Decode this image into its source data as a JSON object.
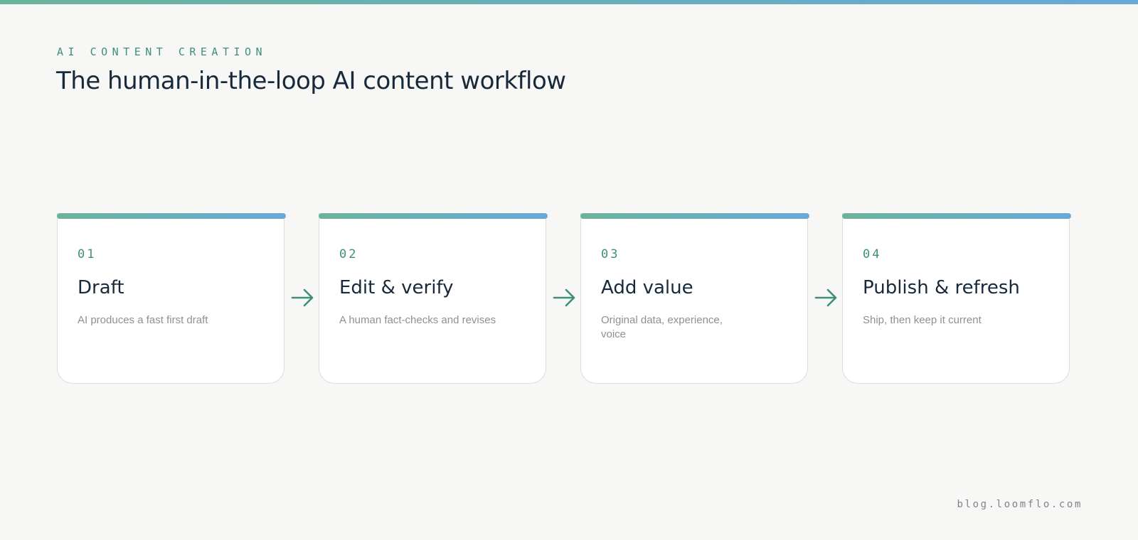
{
  "header": {
    "eyebrow": "AI CONTENT CREATION",
    "title": "The human-in-the-loop AI content workflow"
  },
  "steps": [
    {
      "number": "01",
      "title": "Draft",
      "description": "AI produces a fast first draft"
    },
    {
      "number": "02",
      "title": "Edit & verify",
      "description": "A human fact-checks and revises"
    },
    {
      "number": "03",
      "title": "Add value",
      "description": "Original data, experience, voice"
    },
    {
      "number": "04",
      "title": "Publish & refresh",
      "description": "Ship, then keep it current"
    }
  ],
  "footer": {
    "url": "blog.loomflo.com"
  },
  "colors": {
    "accent_green": "#3f9077",
    "gradient_start": "#6cb39b",
    "gradient_end": "#6aa8d8",
    "title_text": "#17293a",
    "muted_text": "#8a9297",
    "background": "#f7f7f5",
    "card_background": "#ffffff"
  },
  "icons": {
    "connector": "arrow-right-icon"
  }
}
